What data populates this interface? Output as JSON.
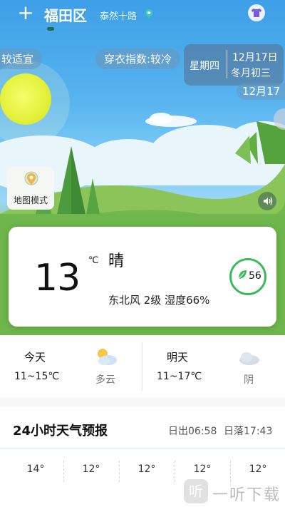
{
  "header": {
    "add_icon": "plus-icon",
    "district": "福田区",
    "street": "泰然十路",
    "location_icon": "location-pin-icon",
    "dress_icon": "shirt-icon"
  },
  "banners": {
    "comfort_partial": "较适宜",
    "clothing_index": "穿衣指数:较冷",
    "weekday": "星期四",
    "date": "12月17日",
    "lunar": "冬月初三",
    "date_partial": "12月17"
  },
  "map_mode": {
    "label": "地图模式",
    "icon": "map-icon"
  },
  "speaker_icon": "speaker-icon",
  "current": {
    "temperature": "13",
    "unit": "℃",
    "condition": "晴",
    "wind_humidity": "东北风 2级  湿度66%",
    "aqi": "56",
    "aqi_color": "#3db85a"
  },
  "forecast": {
    "today": {
      "title": "今天",
      "range": "11~15℃",
      "condition": "多云",
      "icon": "partly-cloudy-icon"
    },
    "tomorrow": {
      "title": "明天",
      "range": "11~17℃",
      "condition": "阴",
      "icon": "cloud-icon"
    }
  },
  "hourly": {
    "title": "24小时天气预报",
    "sunrise": "日出06:58",
    "sunset": "日落17:43",
    "temps": [
      "14°",
      "12°",
      "12°",
      "12°",
      "12°"
    ]
  },
  "watermark": {
    "logo": "听",
    "text": "一听下载"
  }
}
